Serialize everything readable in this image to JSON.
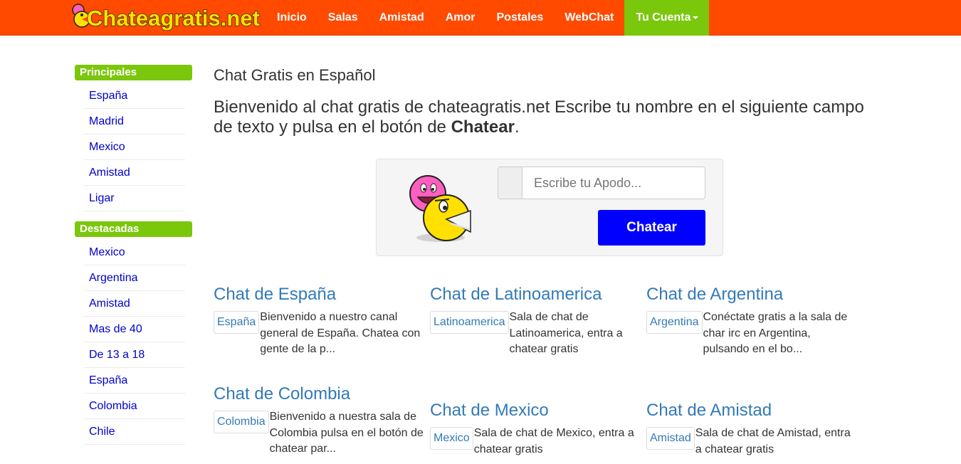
{
  "colors": {
    "navbar": "#ff4a00",
    "accent_green": "#7ac70c",
    "link_blue": "#337ab7",
    "sidebar_link": "#0000cc",
    "button_blue": "#0000ff"
  },
  "brand": {
    "logo_text": "Chateagratis.net"
  },
  "nav": {
    "items": [
      {
        "label": "Inicio"
      },
      {
        "label": "Salas"
      },
      {
        "label": "Amistad"
      },
      {
        "label": "Amor"
      },
      {
        "label": "Postales"
      },
      {
        "label": "WebChat"
      }
    ],
    "account_label": "Tu Cuenta"
  },
  "sidebar": {
    "principales_heading": "Principales",
    "principales": [
      "España",
      "Madrid",
      "Mexico",
      "Amistad",
      "Ligar"
    ],
    "destacadas_heading": "Destacadas",
    "destacadas": [
      "Mexico",
      "Argentina",
      "Amistad",
      "Mas de 40",
      "De 13 a 18",
      "España",
      "Colombia",
      "Chile"
    ]
  },
  "main": {
    "title": "Chat Gratis en Español",
    "intro_text": "Bienvenido al chat gratis de chateagratis.net Escribe tu nombre en el siguiente campo de texto y pulsa en el botón de ",
    "intro_bold": "Chatear",
    "intro_end": "."
  },
  "chat_form": {
    "placeholder": "Escribe tu Apodo...",
    "button_label": "Chatear"
  },
  "rooms": [
    {
      "title": "Chat de España",
      "tag": "España",
      "text": "Bienvenido a nuestro canal general de España. Chatea con gente de la p..."
    },
    {
      "title": "Chat de Latinoamerica",
      "tag": "Latinoamerica",
      "text": "Sala de chat de Latinoamerica, entra a chatear gratis"
    },
    {
      "title": "Chat de Argentina",
      "tag": "Argentina",
      "text": "Conéctate gratis a la sala de char irc en Argentina, pulsando en el bo..."
    },
    {
      "title": "Chat de Colombia",
      "tag": "Colombia",
      "text": "Bienvenido a nuestra sala de Colombia pulsa en el botón de chatear par..."
    },
    {
      "title": "Chat de Mexico",
      "tag": "Mexico",
      "text": "Sala de chat de Mexico, entra a chatear gratis"
    },
    {
      "title": "Chat de Amistad",
      "tag": "Amistad",
      "text": "Sala de chat de Amistad, entra a chatear gratis"
    }
  ]
}
